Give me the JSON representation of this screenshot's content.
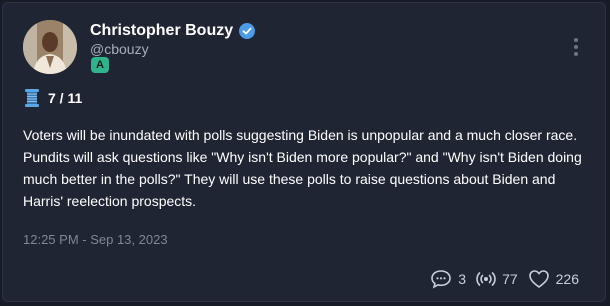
{
  "post": {
    "author_name": "Christopher Bouzy",
    "handle": "@cbouzy",
    "badge_letter": "A",
    "thread_position": "7 / 11",
    "text": "Voters will be inundated with polls suggesting Biden is unpopular and a much closer race. Pundits will ask questions like \"Why isn't Biden more popular?\" and \"Why isn't Biden doing much better in the polls?\" They will use these polls to raise questions about Biden and Harris' reelection prospects.",
    "timestamp": "12:25 PM - Sep 13, 2023"
  },
  "stats": {
    "comments": "3",
    "reposts": "77",
    "likes": "226"
  },
  "icons": {
    "verified": "verified-badge-icon",
    "thread": "spool-thread-icon",
    "more": "vertical-ellipsis-icon",
    "comment": "speech-bubble-icon",
    "repost": "broadcast-icon",
    "like": "heart-icon"
  },
  "colors": {
    "background": "#1f2533",
    "verified": "#4a9be8",
    "badge": "#2fb38a",
    "thread_icon": "#5aa7e6"
  }
}
